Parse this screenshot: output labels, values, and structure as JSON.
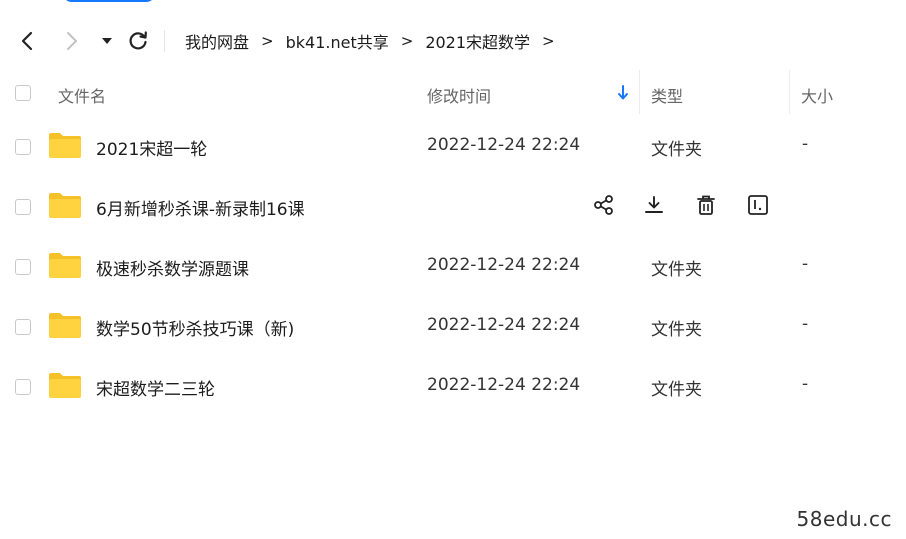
{
  "breadcrumb": [
    {
      "label": "我的网盘"
    },
    {
      "label": "bk41.net共享"
    },
    {
      "label": "2021宋超数学"
    }
  ],
  "breadcrumb_separator": ">",
  "columns": {
    "name": "文件名",
    "modified": "修改时间",
    "type": "类型",
    "size": "大小"
  },
  "files": [
    {
      "name": "2021宋超一轮",
      "modified": "2022-12-24 22:24",
      "type": "文件夹",
      "size": "-"
    },
    {
      "name": "6月新增秒杀课-新录制16课",
      "modified": "",
      "type": "",
      "size": "",
      "hovered": true
    },
    {
      "name": "极速秒杀数学源题课",
      "modified": "2022-12-24 22:24",
      "type": "文件夹",
      "size": "-"
    },
    {
      "name": "数学50节秒杀技巧课（新)",
      "modified": "2022-12-24 22:24",
      "type": "文件夹",
      "size": "-"
    },
    {
      "name": "宋超数学二三轮",
      "modified": "2022-12-24 22:24",
      "type": "文件夹",
      "size": "-"
    }
  ],
  "icons": {
    "folder": "folder-icon",
    "share": "share-icon",
    "download": "download-icon",
    "delete": "trash-icon",
    "rename": "rename-icon"
  },
  "colors": {
    "accent": "#1677ff",
    "folder": "#ffd23f",
    "folder_back": "#f5c129"
  },
  "watermark": "58edu.cc"
}
